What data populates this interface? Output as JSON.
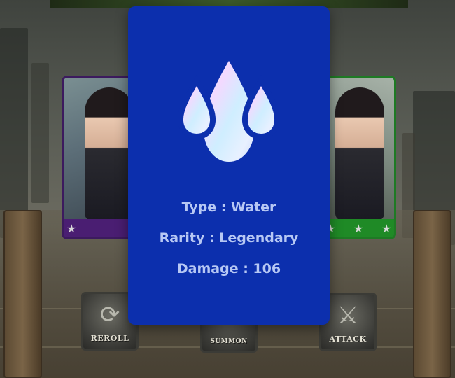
{
  "background": {
    "theme": "ruined-temple"
  },
  "cards": {
    "left": {
      "frame_color": "#3c1a5e",
      "strip_color": "#4a1e72",
      "stars": 1
    },
    "right": {
      "frame_color": "#1e7a24",
      "strip_color": "#1f8a26",
      "stars": 3
    }
  },
  "buttons": {
    "reroll": {
      "label": "REROLL",
      "icon": "reroll-icon"
    },
    "summon": {
      "label": "SUMMON",
      "icon": "summon-icon"
    },
    "attack": {
      "label": "ATTACK",
      "icon": "attack-icon"
    }
  },
  "popup": {
    "background_color": "#0c2fad",
    "element_icon": "water-drops-icon",
    "type_text": "Type : Water",
    "rarity_text": "Rarity : Legendary",
    "damage_text": "Damage : 106"
  }
}
